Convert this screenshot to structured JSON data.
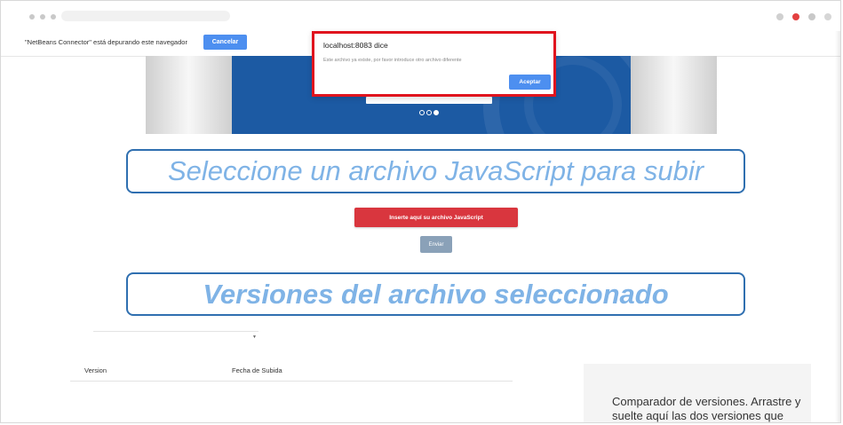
{
  "infobar": {
    "message": "\"NetBeans Connector\" está depurando este navegador",
    "cancel_label": "Cancelar"
  },
  "dialog": {
    "title": "localhost:8083 dice",
    "message": "Este archivo ya existe, por favor introduce otro archivo diferente",
    "ok_label": "Aceptar"
  },
  "carousel": {
    "slide_count": 3,
    "active_slide": 3
  },
  "upload": {
    "heading": "Seleccione un archivo JavaScript para subir",
    "file_button_label": "Inserte aquí su archivo JavaScript",
    "send_label": "Enviar"
  },
  "versions": {
    "heading": "Versiones del archivo seleccionado",
    "columns": [
      "Version",
      "Fecha de Subida"
    ]
  },
  "comparator": {
    "text": "Comparador de versiones. Arrastre y suelte aquí las dos versiones que"
  },
  "colors": {
    "dialog_border": "#e0141e",
    "accent_blue": "#4d8ff0",
    "file_button": "#d9363e",
    "heading_text": "#7fb3e6",
    "heading_border": "#2f6fb0",
    "banner": "#1c5aa3"
  }
}
